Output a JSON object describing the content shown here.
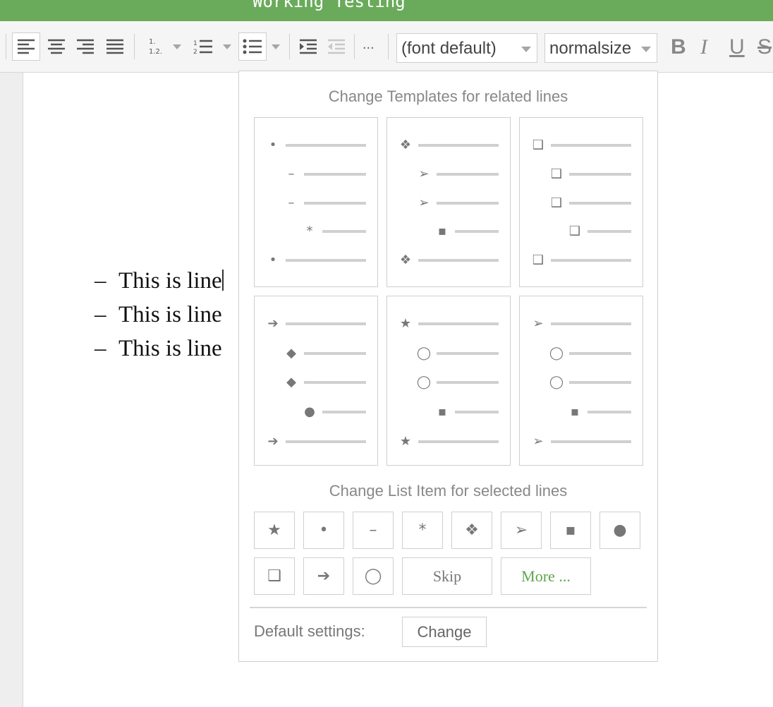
{
  "window": {
    "title": "Working Testing"
  },
  "toolbar": {
    "font_select": "(font default)",
    "size_select": "normalsize",
    "more_label": "...",
    "bold": "B",
    "italic": "I",
    "underline": "U",
    "strike": "S"
  },
  "document": {
    "lines": [
      {
        "bullet": "–",
        "text": "This is line"
      },
      {
        "bullet": "–",
        "text": "This is line"
      },
      {
        "bullet": "–",
        "text": "This is line"
      }
    ]
  },
  "popup": {
    "templates_heading": "Change Templates for related lines",
    "list_item_heading": "Change List Item for selected lines",
    "templates": [
      {
        "symbols": [
          "•",
          "–",
          "–",
          "*",
          "•"
        ]
      },
      {
        "symbols": [
          "❖",
          "➢",
          "➢",
          "▪",
          "❖"
        ]
      },
      {
        "symbols": [
          "❑",
          "❑",
          "❑",
          "❑",
          "❑"
        ]
      },
      {
        "symbols": [
          "➔",
          "◆",
          "◆",
          "●",
          "➔"
        ]
      },
      {
        "symbols": [
          "★",
          "◯",
          "◯",
          "▪",
          "★"
        ]
      },
      {
        "symbols": [
          "➢",
          "◯",
          "◯",
          "▪",
          "➢"
        ]
      }
    ],
    "list_items_row1": [
      "★",
      "•",
      "–",
      "*",
      "❖",
      "➢",
      "▪",
      "●"
    ],
    "list_items_row2": [
      "❑",
      "➔",
      "◯"
    ],
    "skip_label": "Skip",
    "more_label": "More ...",
    "default_settings_label": "Default settings:",
    "change_label": "Change"
  }
}
